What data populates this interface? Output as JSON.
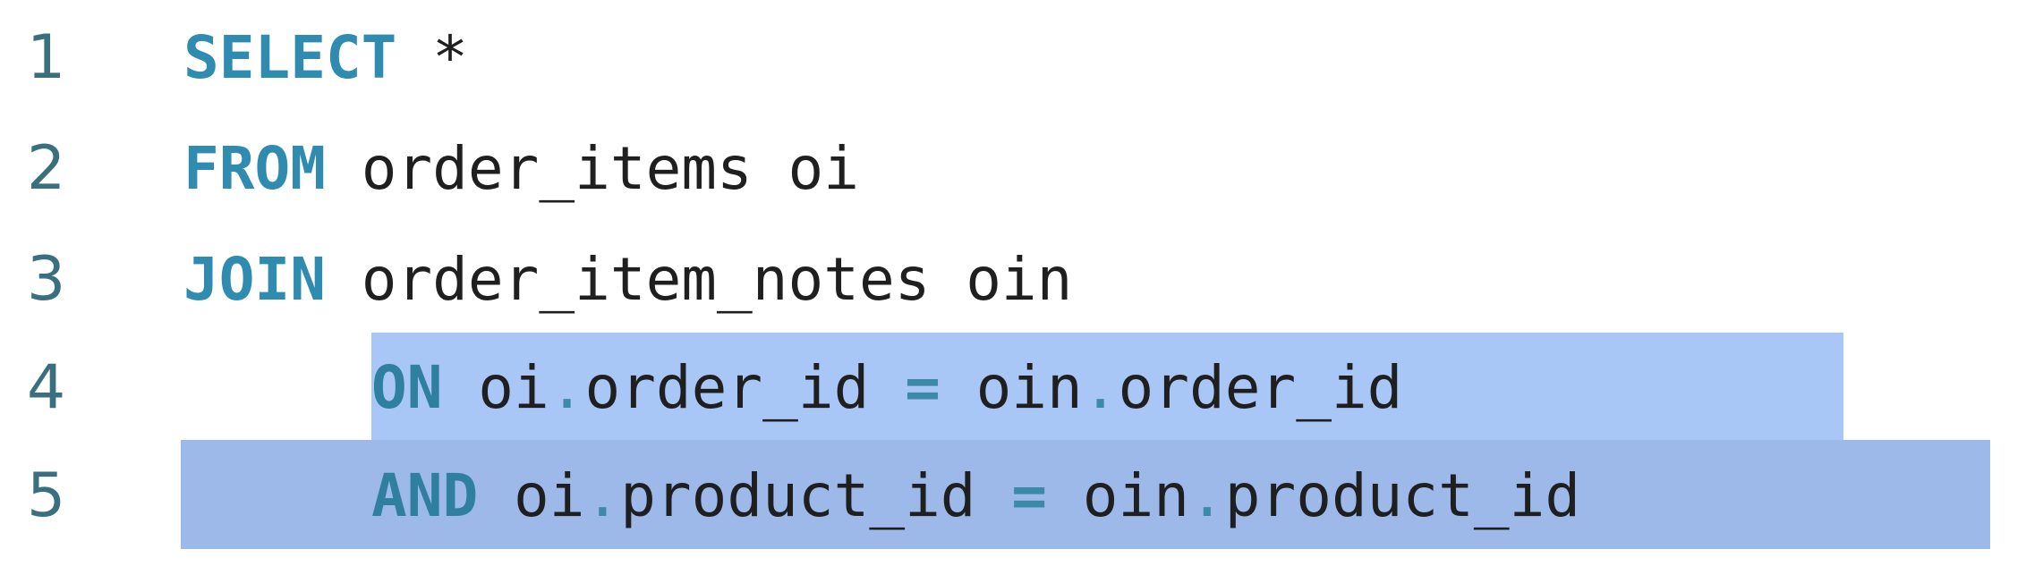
{
  "editor": {
    "lines": [
      {
        "number": "1",
        "keyword": "SELECT",
        "rest": " *"
      },
      {
        "number": "2",
        "keyword": "FROM",
        "rest": " order_items oi"
      },
      {
        "number": "3",
        "keyword": "JOIN",
        "rest": " order_item_notes oin"
      },
      {
        "number": "4",
        "keyword": "ON",
        "left_alias": " oi",
        "left_col": "order_id",
        "op": " = ",
        "right_alias": "oin",
        "right_col": "order_id"
      },
      {
        "number": "5",
        "keyword": "AND",
        "left_alias": " oi",
        "left_col": "product_id",
        "op": " = ",
        "right_alias": "oin",
        "right_col": "product_id"
      }
    ],
    "dot": ".",
    "colors": {
      "keyword": "#2f8bb0",
      "line_number": "#3a6f80",
      "selection": "#a9c7f6",
      "selection_line": "#9db9ea",
      "text": "#1f1f1f"
    }
  }
}
